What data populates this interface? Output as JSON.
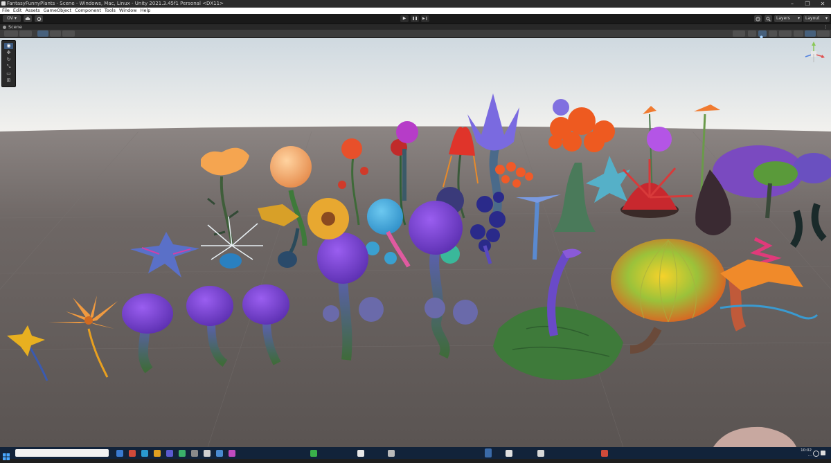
{
  "window": {
    "title": "FantasyFunnyPlants - Scene - Windows, Mac, Linux - Unity 2021.3.45f1 Personal <DX11>",
    "controls": {
      "minimize": "–",
      "maximize": "❐",
      "close": "✕"
    }
  },
  "menu": {
    "items": [
      "File",
      "Edit",
      "Assets",
      "GameObject",
      "Component",
      "Tools",
      "Window",
      "Help"
    ]
  },
  "toolbar": {
    "account_label": "OV",
    "cloud_icon": "cloud-icon",
    "collab_icon": "settings-icon",
    "play_icon": "▶",
    "pause_icon": "❚❚",
    "step_icon": "▶❙",
    "history_icon": "history-icon",
    "search_icon": "search-icon",
    "layers_label": "Layers",
    "layout_label": "Layout"
  },
  "scene_tab": {
    "label": "Scene"
  },
  "taskbar": {
    "time": "10:02",
    "date": "..."
  },
  "colors": {
    "sky_top": "#dde4e9",
    "sky_horizon": "#f0f0ee",
    "ground": "#66605e",
    "accent_blue": "#3d5a80",
    "purple_cap": "#7a3fd0",
    "taskbar": "#12233a"
  }
}
